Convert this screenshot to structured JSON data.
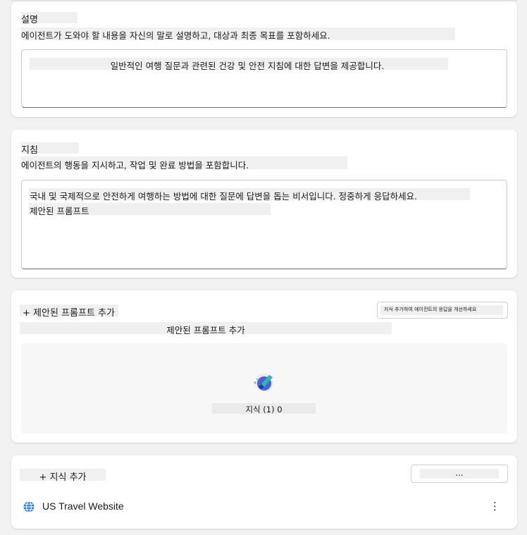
{
  "description": {
    "label": "설명",
    "help": "에이전트가 도와야 할 내용을 자신의 말로 설명하고, 대상과 최종 목표를 포함하세요.",
    "value": "일반적인 여행 질문과 관련된 건강 및 안전 지침에 대한 답변을 제공합니다."
  },
  "instructions": {
    "label": "지침",
    "help": "에이전트의 행동을 지시하고, 작업 및 완료 방법을 포함합니다.",
    "value_line1": "국내 및 국제적으로 안전하게 여행하는 방법에 대한 질문에 답변을 돕는 비서입니다. 정중하게 응답하세요.",
    "value_line2": "제안된 프롬프트"
  },
  "prompts": {
    "add_label": "+ 제안된 프롬프트 추가",
    "right_button": "지식 추가하여 에이전트의 응답을 개선하세요",
    "subtitle": "제안된 프롬프트 추가",
    "knowledge_count": "지식 (1) 0"
  },
  "knowledge": {
    "add_label": "+ 지식 추가",
    "more_button": "...",
    "item_name": "US Travel Website",
    "item_menu": "⋮"
  }
}
